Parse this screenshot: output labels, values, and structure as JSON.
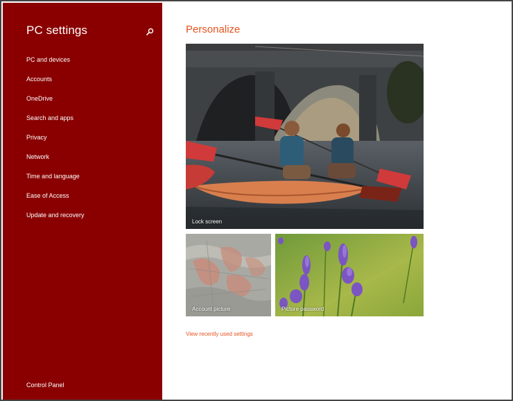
{
  "sidebar": {
    "title": "PC settings",
    "items": [
      {
        "label": "PC and devices"
      },
      {
        "label": "Accounts"
      },
      {
        "label": "OneDrive"
      },
      {
        "label": "Search and apps"
      },
      {
        "label": "Privacy"
      },
      {
        "label": "Network"
      },
      {
        "label": "Time and language"
      },
      {
        "label": "Ease of Access"
      },
      {
        "label": "Update and recovery"
      }
    ],
    "footer_label": "Control Panel",
    "search_icon": "search-icon"
  },
  "main": {
    "title": "Personalize",
    "tiles": [
      {
        "label": "Lock screen"
      },
      {
        "label": "Account picture"
      },
      {
        "label": "Picture password"
      }
    ],
    "recent_link": "View recently used settings"
  },
  "colors": {
    "sidebar_bg": "#8a0000",
    "accent": "#e4531f",
    "text_on_accent": "#ffffff"
  }
}
